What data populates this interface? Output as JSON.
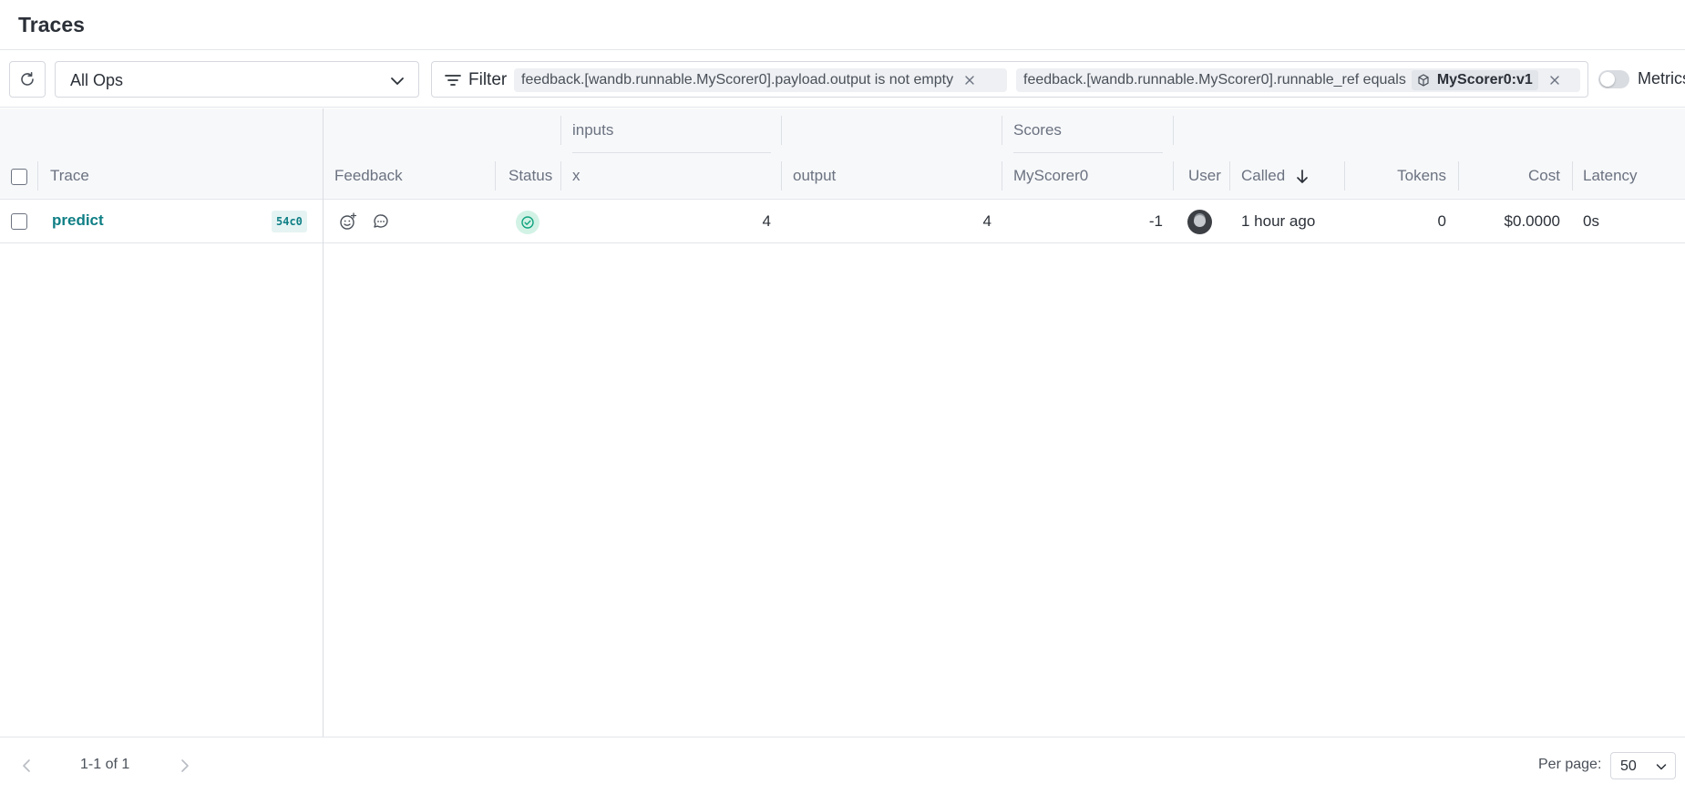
{
  "page": {
    "title": "Traces"
  },
  "toolbar": {
    "ops_select": {
      "value": "All Ops"
    },
    "filter": {
      "label": "Filter",
      "chips": [
        {
          "text": "feedback.[wandb.runnable.MyScorer0].payload.output is not empty"
        },
        {
          "text": "feedback.[wandb.runnable.MyScorer0].runnable_ref equals",
          "ref": "MyScorer0:v1"
        }
      ]
    },
    "metrics": {
      "label": "Metrics",
      "on": false
    }
  },
  "table": {
    "groups": {
      "inputs": "inputs",
      "scores": "Scores"
    },
    "columns": {
      "trace": "Trace",
      "feedback": "Feedback",
      "status": "Status",
      "x": "x",
      "output": "output",
      "myscorer0": "MyScorer0",
      "user": "User",
      "called": "Called",
      "tokens": "Tokens",
      "cost": "Cost",
      "latency": "Latency"
    },
    "sort": {
      "column": "Called",
      "direction": "descending"
    },
    "rows": [
      {
        "trace": "predict",
        "trace_id": "54c0",
        "status": "success",
        "x": "4",
        "output": "4",
        "myscorer0": "-1",
        "called": "1 hour ago",
        "tokens": "0",
        "cost": "$0.0000",
        "latency": "0s"
      }
    ]
  },
  "footer": {
    "range": "1-1 of 1",
    "per_page_label": "Per page:",
    "per_page_value": "50"
  },
  "colors": {
    "accent": "#0f7f85",
    "success_bg": "#d3f2e6",
    "success_fg": "#11a37f"
  }
}
